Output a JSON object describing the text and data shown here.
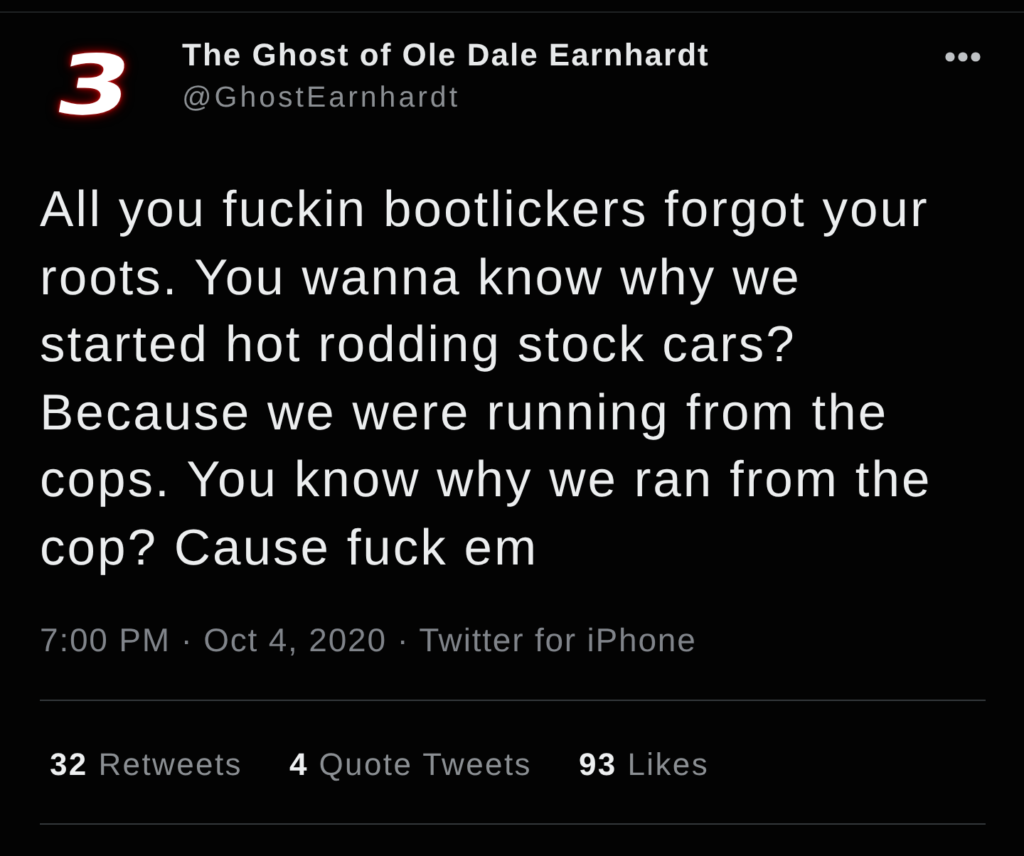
{
  "author": {
    "avatar_text": "3",
    "name": "The Ghost of Ole Dale Earnhardt",
    "handle": "@GhostEarnhardt"
  },
  "tweet": {
    "text": "All you fuckin bootlickers forgot your roots. You wanna know why we started hot rodding stock cars? Because we were running from the cops. You know why we ran from the cop? Cause fuck em",
    "timestamp": "7:00 PM · Oct 4, 2020 · Twitter for iPhone"
  },
  "stats": [
    {
      "count": "32",
      "label": "Retweets"
    },
    {
      "count": "4",
      "label": "Quote Tweets"
    },
    {
      "count": "93",
      "label": "Likes"
    }
  ]
}
